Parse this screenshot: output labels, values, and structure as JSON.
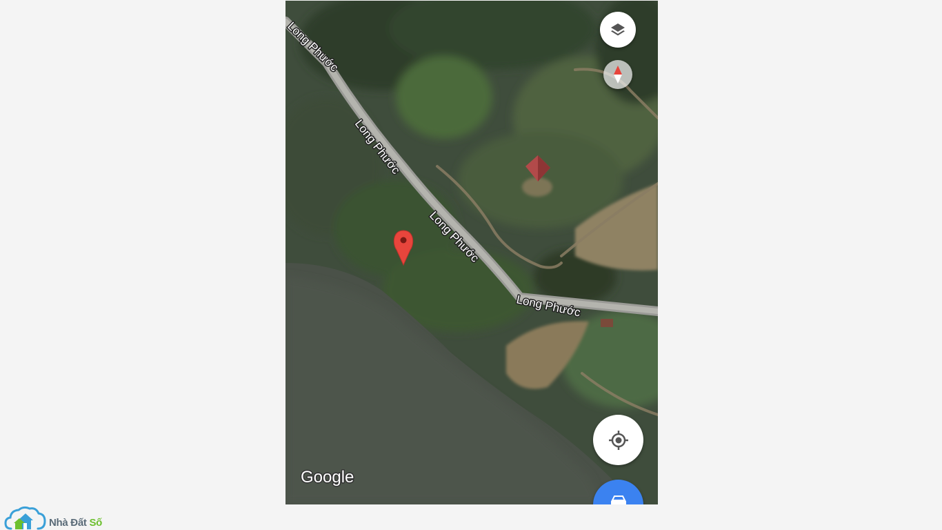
{
  "map": {
    "road_name": "Long Phước",
    "road_labels": [
      "Long Phước",
      "Long Phước",
      "Long Phước",
      "Long Phước"
    ],
    "attribution": "Google",
    "marker_color": "#e8453c",
    "map_type": "satellite"
  },
  "controls": {
    "layers_icon": "layers-icon",
    "compass_icon": "compass-icon",
    "location_icon": "my-location-icon",
    "directions_icon": "car-icon",
    "directions_color": "#3b82f0"
  },
  "watermark": {
    "brand_part1": "Nhà Đất ",
    "brand_part2": "Số",
    "brand_color1": "#5a6b78",
    "brand_color2": "#6cbf2e",
    "logo_icon": "cloud-house-icon"
  }
}
